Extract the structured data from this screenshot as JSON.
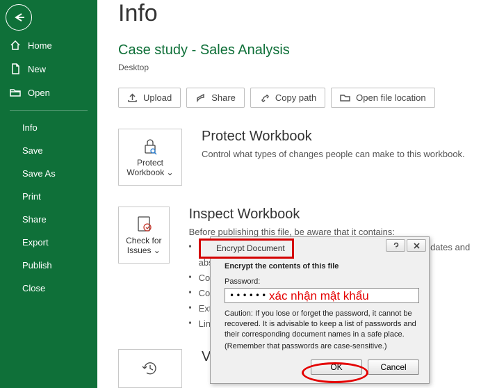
{
  "sidebar": {
    "links": [
      {
        "label": "Home"
      },
      {
        "label": "New"
      },
      {
        "label": "Open"
      }
    ],
    "subs": [
      {
        "label": "Info"
      },
      {
        "label": "Save"
      },
      {
        "label": "Save As"
      },
      {
        "label": "Print"
      },
      {
        "label": "Share"
      },
      {
        "label": "Export"
      },
      {
        "label": "Publish"
      },
      {
        "label": "Close"
      }
    ]
  },
  "page": {
    "title": "Info",
    "doc_title": "Case study - Sales Analysis",
    "doc_location": "Desktop"
  },
  "actions": {
    "upload": "Upload",
    "share": "Share",
    "copy_path": "Copy path",
    "open_loc": "Open file location"
  },
  "protect": {
    "tile": "Protect Workbook",
    "chev": "⌄",
    "heading": "Protect Workbook",
    "desc": "Control what types of changes people can make to this workbook."
  },
  "inspect": {
    "tile": "Check for Issues",
    "chev": "⌄",
    "heading": "Inspect Workbook",
    "lead": "Before publishing this file, be aware that it contains:",
    "bullets": [
      "Document properties, printer path, author's name, related dates and absolute type information,",
      "Content that people with disabilities find difficult to read",
      "Content that people with disabilities are unable to read",
      "External links that refresh automatically",
      "Links to other files"
    ]
  },
  "version": {
    "tile": "Version History",
    "heading": "Version History"
  },
  "dialog": {
    "title": "Encrypt Document",
    "header": "Encrypt the contents of this file",
    "pw_label": "Password:",
    "pw_value": "••••••",
    "caution": "Caution: If you lose or forget the password, it cannot be recovered. It is advisable to keep a list of passwords and their corresponding document names in a safe place.",
    "remember": "(Remember that passwords are case-sensitive.)",
    "ok": "OK",
    "cancel": "Cancel"
  },
  "annotation": {
    "text": "xác nhận mật khẩu"
  }
}
